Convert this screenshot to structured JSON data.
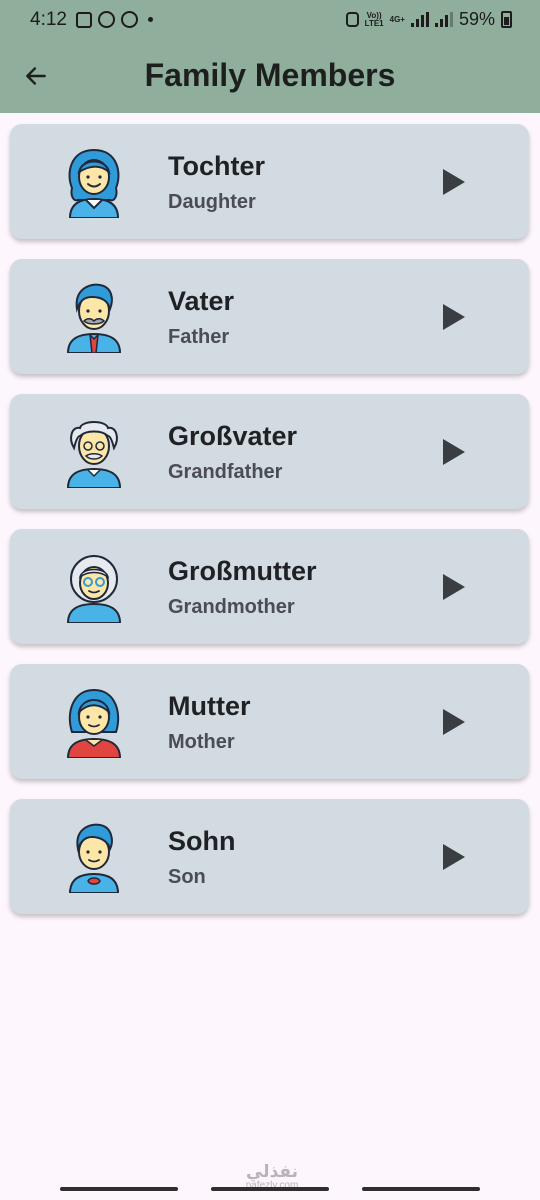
{
  "status_bar": {
    "time": "4:12",
    "network_label_top": "Vo))",
    "network_label_bottom": "LTE1",
    "network_type": "4G+",
    "battery": "59%"
  },
  "app_bar": {
    "title": "Family Members",
    "back_icon": "arrow-left-icon"
  },
  "members": [
    {
      "name": "Tochter",
      "translation": "Daughter",
      "icon": "daughter-avatar-icon"
    },
    {
      "name": "Vater",
      "translation": "Father",
      "icon": "father-avatar-icon"
    },
    {
      "name": "Großvater",
      "translation": "Grandfather",
      "icon": "grandfather-avatar-icon"
    },
    {
      "name": "Großmutter",
      "translation": "Grandmother",
      "icon": "grandmother-avatar-icon"
    },
    {
      "name": "Mutter",
      "translation": "Mother",
      "icon": "mother-avatar-icon"
    },
    {
      "name": "Sohn",
      "translation": "Son",
      "icon": "son-avatar-icon"
    }
  ],
  "watermark": {
    "logo": "نفذلي",
    "site": "nafezly.com"
  },
  "colors": {
    "app_bar": "#8fae9c",
    "card": "#d3dbe2",
    "background": "#fdf6fc",
    "avatar_blue": "#2f9bd9",
    "skin": "#fce7a9"
  }
}
